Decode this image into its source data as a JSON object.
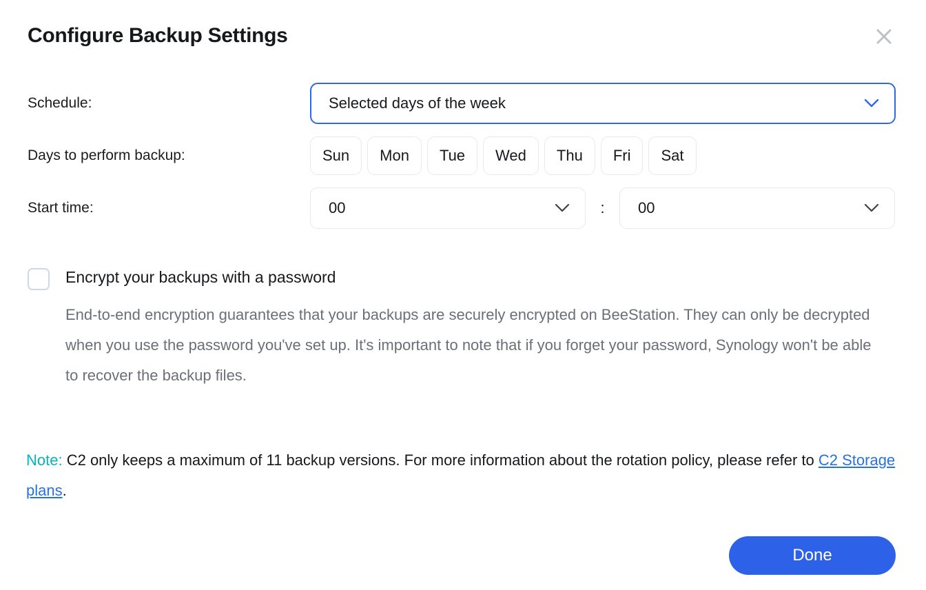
{
  "dialog": {
    "title": "Configure Backup Settings",
    "close_icon": "close-icon"
  },
  "form": {
    "schedule": {
      "label": "Schedule:",
      "value": "Selected days of the week",
      "chevron_icon": "chevron-down-icon",
      "focused": true
    },
    "days": {
      "label": "Days to perform backup:",
      "items": [
        {
          "label": "Sun",
          "selected": false
        },
        {
          "label": "Mon",
          "selected": false
        },
        {
          "label": "Tue",
          "selected": false
        },
        {
          "label": "Wed",
          "selected": false
        },
        {
          "label": "Thu",
          "selected": false
        },
        {
          "label": "Fri",
          "selected": false
        },
        {
          "label": "Sat",
          "selected": false
        }
      ]
    },
    "start_time": {
      "label": "Start time:",
      "hour": "00",
      "minute": "00",
      "separator": ":",
      "chevron_icon": "chevron-down-icon"
    }
  },
  "encryption": {
    "checkbox_label": "Encrypt your backups with a password",
    "checked": false,
    "description": "End-to-end encryption guarantees that your backups are securely encrypted on BeeStation. They can only be decrypted when you use the password you've set up. It's important to note that if you forget your password, Synology won't be able to recover the backup files."
  },
  "note": {
    "keyword": "Note:",
    "text_before": " C2 only keeps a maximum of 11 backup versions. For more information about the rotation policy, please refer to ",
    "link_text": "C2 Storage plans",
    "text_after": "."
  },
  "footer": {
    "done_label": "Done"
  },
  "colors": {
    "accent": "#2d62e8",
    "focus_border": "#2d6ae0",
    "note_keyword": "#00b6bd",
    "link": "#2571e6",
    "muted_text": "#6b6f76"
  }
}
